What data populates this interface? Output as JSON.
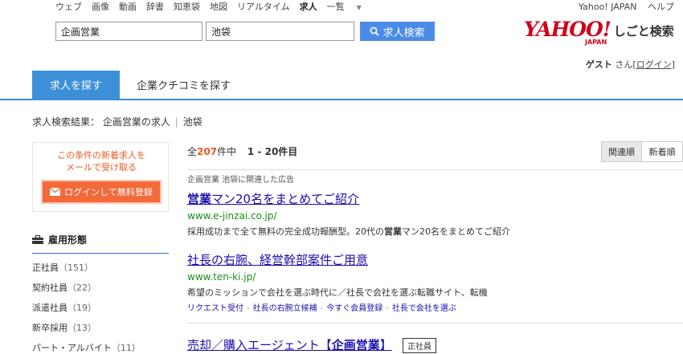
{
  "topnav": {
    "items": [
      "ウェブ",
      "画像",
      "動画",
      "辞書",
      "知恵袋",
      "地図",
      "リアルタイム",
      "求人",
      "一覧"
    ],
    "links": [
      "Yahoo! JAPAN",
      "ヘルプ"
    ]
  },
  "search": {
    "keyword_value": "企画営業",
    "location_value": "池袋",
    "button_label": "求人検索"
  },
  "logo": {
    "yahoo": "YAHOO!",
    "japan": "JAPAN",
    "service": "しごと検索"
  },
  "user": {
    "name": "ゲスト",
    "suffix": "さん",
    "login_open": "[",
    "login": "ログイン",
    "login_close": "]"
  },
  "tabs": {
    "active": "求人を探す",
    "other": "企業クチコミを探す"
  },
  "breadcrumb": {
    "label": "求人検索結果：",
    "query": "企画営業の求人",
    "sep": "|",
    "location": "池袋"
  },
  "alert": {
    "line1": "この条件の新着求人を",
    "line2": "メールで受け取る",
    "button": "ログインして無料登録"
  },
  "sidebar": {
    "heading": "雇用形態",
    "items": [
      {
        "label": "正社員",
        "count": "（151）"
      },
      {
        "label": "契約社員",
        "count": "（22）"
      },
      {
        "label": "派遣社員",
        "count": "（19）"
      },
      {
        "label": "新卒採用",
        "count": "（13）"
      },
      {
        "label": "パート・アルバイト",
        "count": "（11）"
      }
    ]
  },
  "results": {
    "total_prefix": "全",
    "total": "207",
    "total_suffix": "件中",
    "range": "1 - 20件目",
    "sort_relevance": "関連順",
    "sort_new": "新着順",
    "ad_label": "企画営業 池袋に関連した広告"
  },
  "ads": [
    {
      "title_bold": "営業",
      "title_rest": "マン20名をまとめてご紹介",
      "url": "www.e-jinzai.co.jp/",
      "desc_pre": "採用成功まで全て無料の完全成功報酬型。20代の",
      "desc_bold": "営業",
      "desc_post": "マン20名をまとめてご紹介"
    },
    {
      "title": "社長の右腕、経営幹部案件ご用意",
      "url": "www.ten-ki.jp/",
      "desc": "希望のミッションで会社を選ぶ時代に／社長で会社を選ぶ転職サイト、転機",
      "links": [
        "リクエスト受付",
        "社長の右腕立候補",
        "今すぐ会員登録",
        "社長で会社を選ぶ"
      ]
    }
  ],
  "job": {
    "title_pre": "売却／購入エージェント【",
    "title_bold": "企画営業",
    "title_post": "】",
    "tag": "正社員"
  },
  "colors": {
    "accent": "#3d8fd8",
    "orange": "#f05a1e",
    "link": "#1a0dab",
    "url": "#1e8c1e",
    "yahoo_red": "#d0021b"
  }
}
